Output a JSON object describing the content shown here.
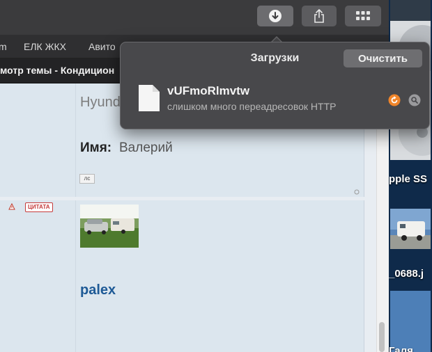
{
  "bookmarks": [
    "m",
    "ЕЛК ЖКХ",
    "Авито"
  ],
  "tab": {
    "title": "мотр темы - Кондицион"
  },
  "posts": {
    "first": {
      "partial_text": "Hyund",
      "name_label": "Имя:",
      "name_value": "Валерий",
      "pm_badge": "лс"
    },
    "second": {
      "quote_badge": "ЦИТАТА",
      "author_link": "palex"
    }
  },
  "downloads": {
    "title": "Загрузки",
    "clear_label": "Очистить",
    "item": {
      "filename": "vUFmoRlmvtw",
      "status": "слишком много переадресовок HTTP"
    }
  },
  "desktop": {
    "labels": [
      "pple SS",
      "_0688.j",
      "Галя"
    ]
  },
  "colors": {
    "accent_orange": "#f0852a",
    "link_blue": "#1e5a96"
  }
}
